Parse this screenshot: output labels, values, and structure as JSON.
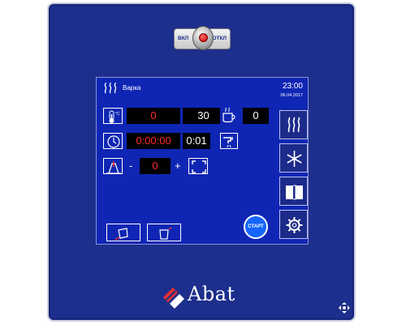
{
  "switch": {
    "on_label": "ВКЛ",
    "off_label": "ОТКЛ"
  },
  "header": {
    "mode": "Варка",
    "time": "23:00",
    "date": "06.04.2017"
  },
  "rows": {
    "temperature": {
      "actual": "0",
      "set": "30"
    },
    "timer": {
      "elapsed": "0:00:00",
      "set": "0:01"
    },
    "humidity": {
      "minus": "-",
      "value": "0",
      "plus": "+"
    },
    "cup": {
      "value": "0"
    }
  },
  "buttons": {
    "start": "СТАРТ"
  },
  "brand": {
    "name": "Abat"
  },
  "colors": {
    "panel": "#1d2f8c",
    "screen": "#0f26b4",
    "value_red": "#ff2a2a",
    "start": "#1565ff"
  }
}
